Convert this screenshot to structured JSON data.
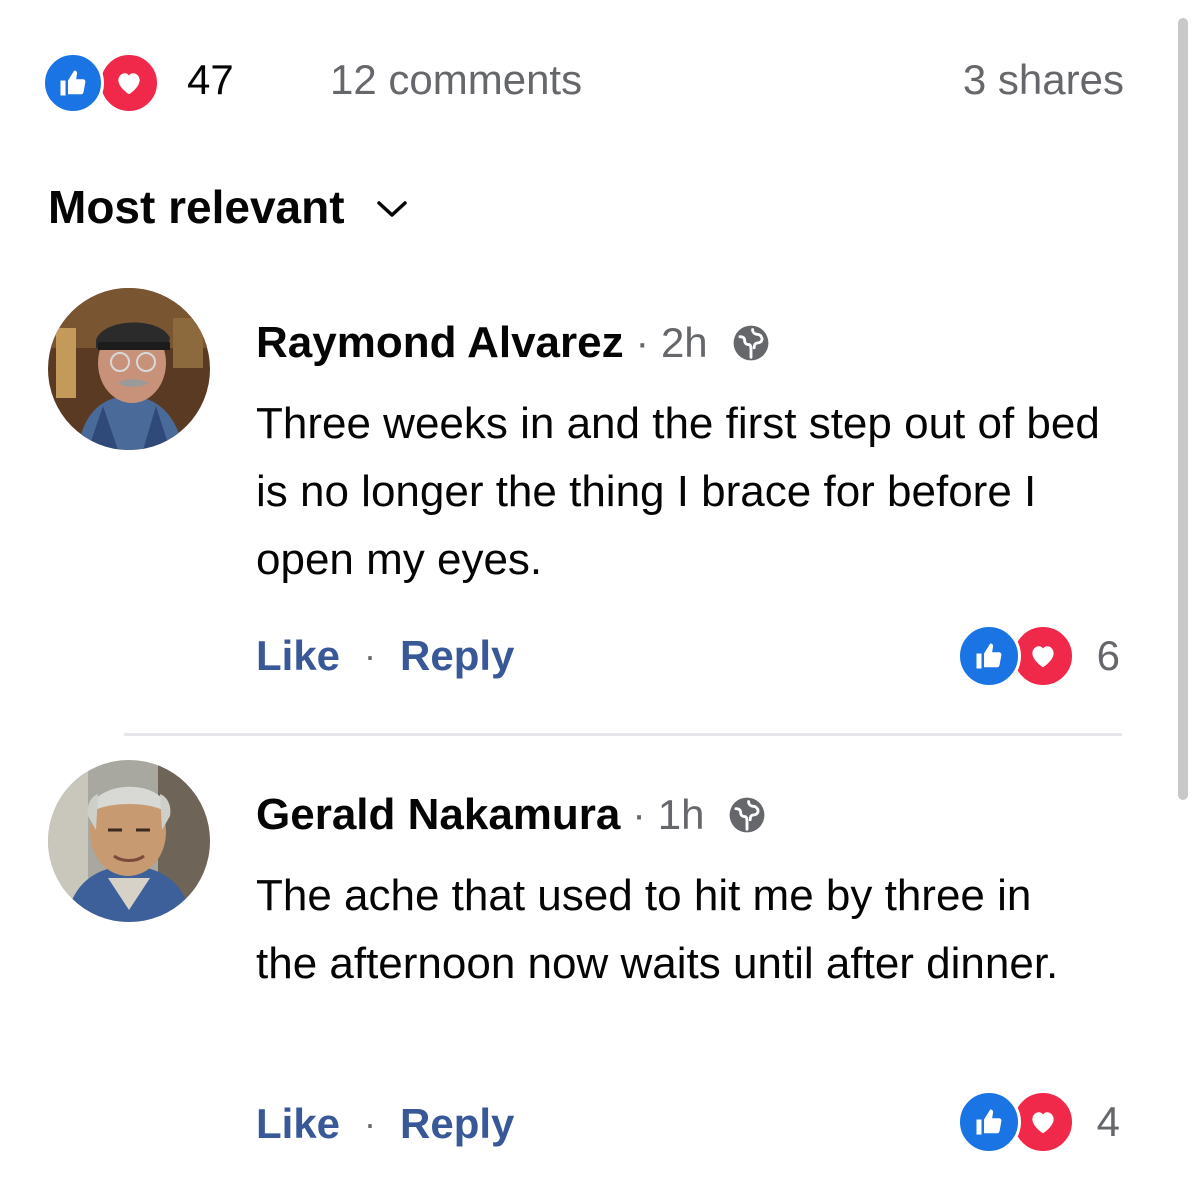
{
  "summary": {
    "reaction_count": "47",
    "comments_label": "12 comments",
    "shares_label": "3 shares",
    "reaction_icons": [
      "like-icon",
      "love-icon"
    ]
  },
  "sort": {
    "label": "Most relevant",
    "icon": "chevron-down-icon"
  },
  "comments": [
    {
      "author": "Raymond Alvarez",
      "time": "2h",
      "separator": "·",
      "audience_icon": "globe-icon",
      "text": "Three weeks in and the first step out of bed is no longer the thing I brace for before I open my eyes.",
      "like_label": "Like",
      "reply_label": "Reply",
      "reaction_count": "6"
    },
    {
      "author": "Gerald Nakamura",
      "time": "1h",
      "separator": "·",
      "audience_icon": "globe-icon",
      "text": "The ache that used to hit me by three in the afternoon now waits until after dinner.",
      "like_label": "Like",
      "reply_label": "Reply",
      "reaction_count": "4"
    }
  ],
  "colors": {
    "like_blue": "#1b74e4",
    "love_red": "#f02849",
    "link_blue": "#385898",
    "muted_gray": "#65676b",
    "divider": "#e4e6eb"
  }
}
